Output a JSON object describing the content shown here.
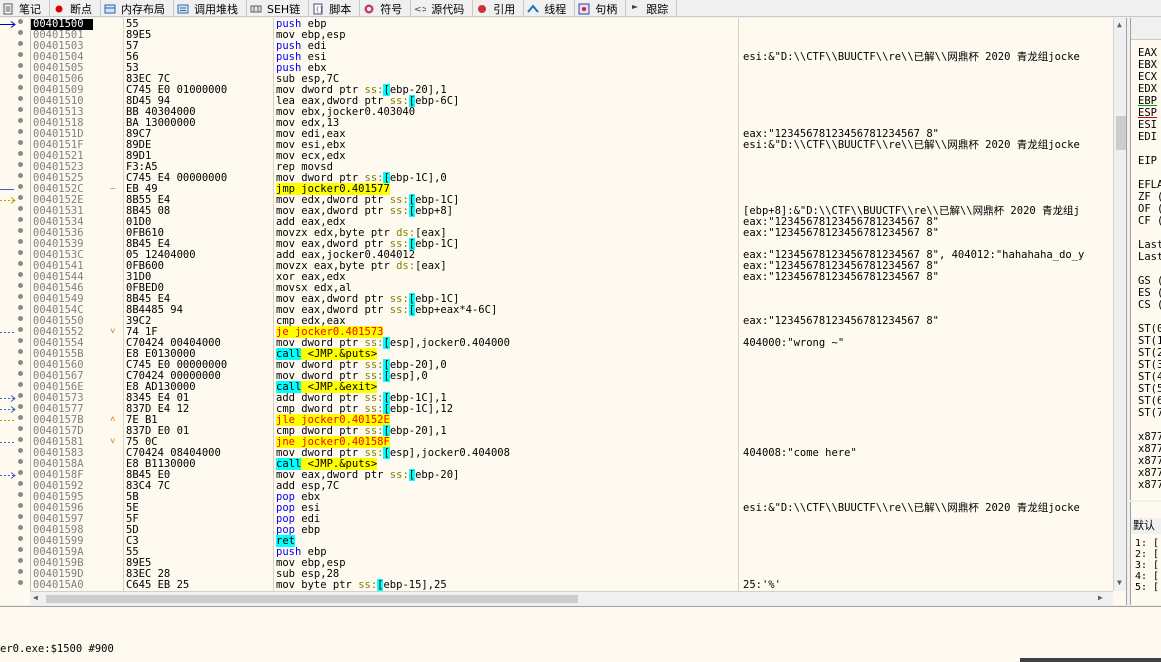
{
  "tabs": [
    {
      "label": "笔记",
      "icon": "notes-icon"
    },
    {
      "label": "断点",
      "icon": "breakpoint-icon"
    },
    {
      "label": "内存布局",
      "icon": "memory-map-icon"
    },
    {
      "label": "调用堆栈",
      "icon": "call-stack-icon"
    },
    {
      "label": "SEH链",
      "icon": "seh-chain-icon"
    },
    {
      "label": "脚本",
      "icon": "script-icon"
    },
    {
      "label": "符号",
      "icon": "symbols-icon"
    },
    {
      "label": "源代码",
      "icon": "source-icon"
    },
    {
      "label": "引用",
      "icon": "references-icon"
    },
    {
      "label": "线程",
      "icon": "threads-icon"
    },
    {
      "label": "句柄",
      "icon": "handles-icon"
    },
    {
      "label": "跟踪",
      "icon": "trace-icon"
    }
  ],
  "disasm": [
    {
      "addr": "00401500",
      "bytes": "55",
      "instr": "push ebp",
      "cmt": ""
    },
    {
      "addr": "00401501",
      "bytes": "89E5",
      "instr": "mov ebp,esp",
      "cmt": ""
    },
    {
      "addr": "00401503",
      "bytes": "57",
      "instr": "push edi",
      "cmt": ""
    },
    {
      "addr": "00401504",
      "bytes": "56",
      "instr": "push esi",
      "cmt": "esi:&\"D:\\\\CTF\\\\BUUCTF\\\\re\\\\已解\\\\网鼎杯 2020 青龙组jocke"
    },
    {
      "addr": "00401505",
      "bytes": "53",
      "instr": "push ebx",
      "cmt": ""
    },
    {
      "addr": "00401506",
      "bytes": "83EC 7C",
      "instr": "sub esp,7C",
      "cmt": ""
    },
    {
      "addr": "00401509",
      "bytes": "C745 E0 01000000",
      "instr": "mov dword ptr ss:[ebp-20],1",
      "cmt": ""
    },
    {
      "addr": "00401510",
      "bytes": "8D45 94",
      "instr": "lea eax,dword ptr ss:[ebp-6C]",
      "cmt": ""
    },
    {
      "addr": "00401513",
      "bytes": "BB 40304000",
      "instr": "mov ebx,jocker0.403040",
      "cmt": ""
    },
    {
      "addr": "00401518",
      "bytes": "BA 13000000",
      "instr": "mov edx,13",
      "cmt": ""
    },
    {
      "addr": "0040151D",
      "bytes": "89C7",
      "instr": "mov edi,eax",
      "cmt": "eax:\"12345678123456781234567 8\""
    },
    {
      "addr": "0040151F",
      "bytes": "89DE",
      "instr": "mov esi,ebx",
      "cmt": "esi:&\"D:\\\\CTF\\\\BUUCTF\\\\re\\\\已解\\\\网鼎杯 2020 青龙组jocke"
    },
    {
      "addr": "00401521",
      "bytes": "89D1",
      "instr": "mov ecx,edx",
      "cmt": ""
    },
    {
      "addr": "00401523",
      "bytes": "F3:A5",
      "instr": "rep movsd",
      "cmt": ""
    },
    {
      "addr": "00401525",
      "bytes": "C745 E4 00000000",
      "instr": "mov dword ptr ss:[ebp-1C],0",
      "cmt": ""
    },
    {
      "addr": "0040152C",
      "bytes": "EB 49",
      "instr": "jmp jocker0.401577",
      "cmt": ""
    },
    {
      "addr": "0040152E",
      "bytes": "8B55 E4",
      "instr": "mov edx,dword ptr ss:[ebp-1C]",
      "cmt": ""
    },
    {
      "addr": "00401531",
      "bytes": "8B45 08",
      "instr": "mov eax,dword ptr ss:[ebp+8]",
      "cmt": "[ebp+8]:&\"D:\\\\CTF\\\\BUUCTF\\\\re\\\\已解\\\\网鼎杯 2020 青龙组j"
    },
    {
      "addr": "00401534",
      "bytes": "01D0",
      "instr": "add eax,edx",
      "cmt": "eax:\"12345678123456781234567 8\""
    },
    {
      "addr": "00401536",
      "bytes": "0FB610",
      "instr": "movzx edx,byte ptr ds:[eax]",
      "cmt": "eax:\"12345678123456781234567 8\""
    },
    {
      "addr": "00401539",
      "bytes": "8B45 E4",
      "instr": "mov eax,dword ptr ss:[ebp-1C]",
      "cmt": ""
    },
    {
      "addr": "0040153C",
      "bytes": "05 12404000",
      "instr": "add eax,jocker0.404012",
      "cmt": "eax:\"12345678123456781234567 8\", 404012:\"hahahaha_do_y"
    },
    {
      "addr": "00401541",
      "bytes": "0FB600",
      "instr": "movzx eax,byte ptr ds:[eax]",
      "cmt": "eax:\"12345678123456781234567 8\""
    },
    {
      "addr": "00401544",
      "bytes": "31D0",
      "instr": "xor eax,edx",
      "cmt": "eax:\"12345678123456781234567 8\""
    },
    {
      "addr": "00401546",
      "bytes": "0FBED0",
      "instr": "movsx edx,al",
      "cmt": ""
    },
    {
      "addr": "00401549",
      "bytes": "8B45 E4",
      "instr": "mov eax,dword ptr ss:[ebp-1C]",
      "cmt": ""
    },
    {
      "addr": "0040154C",
      "bytes": "8B4485 94",
      "instr": "mov eax,dword ptr ss:[ebp+eax*4-6C]",
      "cmt": ""
    },
    {
      "addr": "00401550",
      "bytes": "39C2",
      "instr": "cmp edx,eax",
      "cmt": "eax:\"12345678123456781234567 8\""
    },
    {
      "addr": "00401552",
      "bytes": "74 1F",
      "instr": "je jocker0.401573",
      "cmt": ""
    },
    {
      "addr": "00401554",
      "bytes": "C70424 00404000",
      "instr": "mov dword ptr ss:[esp],jocker0.404000",
      "cmt": "404000:\"wrong ~\""
    },
    {
      "addr": "0040155B",
      "bytes": "E8 E0130000",
      "instr": "call <JMP.&puts>",
      "cmt": ""
    },
    {
      "addr": "00401560",
      "bytes": "C745 E0 00000000",
      "instr": "mov dword ptr ss:[ebp-20],0",
      "cmt": ""
    },
    {
      "addr": "00401567",
      "bytes": "C70424 00000000",
      "instr": "mov dword ptr ss:[esp],0",
      "cmt": ""
    },
    {
      "addr": "0040156E",
      "bytes": "E8 AD130000",
      "instr": "call <JMP.&exit>",
      "cmt": ""
    },
    {
      "addr": "00401573",
      "bytes": "8345 E4 01",
      "instr": "add dword ptr ss:[ebp-1C],1",
      "cmt": ""
    },
    {
      "addr": "00401577",
      "bytes": "837D E4 12",
      "instr": "cmp dword ptr ss:[ebp-1C],12",
      "cmt": ""
    },
    {
      "addr": "0040157B",
      "bytes": "7E B1",
      "instr": "jle jocker0.40152E",
      "cmt": ""
    },
    {
      "addr": "0040157D",
      "bytes": "837D E0 01",
      "instr": "cmp dword ptr ss:[ebp-20],1",
      "cmt": ""
    },
    {
      "addr": "00401581",
      "bytes": "75 0C",
      "instr": "jne jocker0.40158F",
      "cmt": ""
    },
    {
      "addr": "00401583",
      "bytes": "C70424 08404000",
      "instr": "mov dword ptr ss:[esp],jocker0.404008",
      "cmt": "404008:\"come here\""
    },
    {
      "addr": "0040158A",
      "bytes": "E8 B1130000",
      "instr": "call <JMP.&puts>",
      "cmt": ""
    },
    {
      "addr": "0040158F",
      "bytes": "8B45 E0",
      "instr": "mov eax,dword ptr ss:[ebp-20]",
      "cmt": ""
    },
    {
      "addr": "00401592",
      "bytes": "83C4 7C",
      "instr": "add esp,7C",
      "cmt": ""
    },
    {
      "addr": "00401595",
      "bytes": "5B",
      "instr": "pop ebx",
      "cmt": ""
    },
    {
      "addr": "00401596",
      "bytes": "5E",
      "instr": "pop esi",
      "cmt": "esi:&\"D:\\\\CTF\\\\BUUCTF\\\\re\\\\已解\\\\网鼎杯 2020 青龙组jocke"
    },
    {
      "addr": "00401597",
      "bytes": "5F",
      "instr": "pop edi",
      "cmt": ""
    },
    {
      "addr": "00401598",
      "bytes": "5D",
      "instr": "pop ebp",
      "cmt": ""
    },
    {
      "addr": "00401599",
      "bytes": "C3",
      "instr": "ret",
      "cmt": ""
    },
    {
      "addr": "0040159A",
      "bytes": "55",
      "instr": "push ebp",
      "cmt": ""
    },
    {
      "addr": "0040159B",
      "bytes": "89E5",
      "instr": "mov ebp,esp",
      "cmt": ""
    },
    {
      "addr": "0040159D",
      "bytes": "83EC 28",
      "instr": "sub esp,28",
      "cmt": ""
    },
    {
      "addr": "004015A0",
      "bytes": "C645 EB 25",
      "instr": "mov byte ptr ss:[ebp-15],25",
      "cmt": "25:'%'"
    }
  ],
  "registers": [
    "EAX",
    "EBX",
    "ECX",
    "EDX",
    "EBP",
    "ESP",
    "ESI",
    "EDI",
    "",
    "EIP",
    "",
    "EFLA",
    "ZF (",
    "OF (",
    "CF (",
    "",
    "Last",
    "Last",
    "",
    "GS (",
    "ES (",
    "CS (",
    "",
    "ST(0",
    "ST(1",
    "ST(2",
    "ST(3",
    "ST(4",
    "ST(5",
    "ST(6",
    "ST(7",
    "",
    "x877",
    "x877",
    "x877",
    "x877",
    "x877"
  ],
  "stack": {
    "header": "默认",
    "lines": [
      "1: [",
      "2: [",
      "3: [",
      "4: [",
      "5: ["
    ]
  },
  "status": "er0.exe:$1500 #900"
}
